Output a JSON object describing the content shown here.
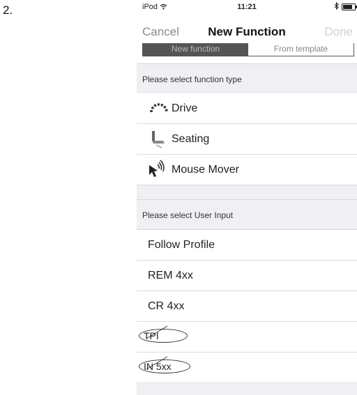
{
  "step_label": "2.",
  "status": {
    "carrier": "iPod",
    "time": "11:21"
  },
  "nav": {
    "cancel": "Cancel",
    "title": "New Function",
    "done": "Done"
  },
  "segments": [
    {
      "label": "New function",
      "selected": true
    },
    {
      "label": "From template",
      "selected": false
    }
  ],
  "function_section": {
    "header": "Please select function type",
    "items": [
      {
        "label": "Drive",
        "icon": "drive-icon"
      },
      {
        "label": "Seating",
        "icon": "seating-icon"
      },
      {
        "label": "Mouse Mover",
        "icon": "mouse-mover-icon"
      }
    ]
  },
  "input_section": {
    "header": "Please select User Input",
    "items": [
      {
        "label": "Follow Profile",
        "crossed_out": false
      },
      {
        "label": "REM 4xx",
        "crossed_out": false
      },
      {
        "label": "CR 4xx",
        "crossed_out": false
      },
      {
        "label": "TPI",
        "crossed_out": true
      },
      {
        "label": "IN 5xx",
        "crossed_out": true
      }
    ]
  }
}
